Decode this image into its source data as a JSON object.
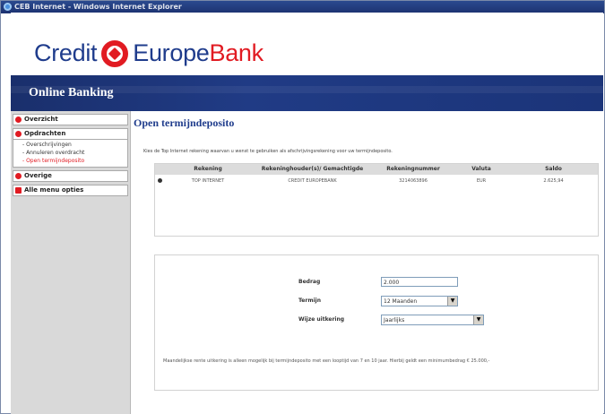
{
  "window": {
    "title": "CEB Internet - Windows Internet Explorer"
  },
  "brand": {
    "logo_word_1": "Credit",
    "logo_word_2": "Europe",
    "logo_word_3": "Bank",
    "brand_red": "#e11b22",
    "brand_blue": "#1f3c8c"
  },
  "banner": {
    "title": "Online Banking"
  },
  "sidebar": {
    "items": [
      {
        "label": "Overzicht"
      },
      {
        "label": "Opdrachten"
      },
      {
        "label": "Overige"
      },
      {
        "label": "Alle menu opties"
      }
    ],
    "sub_items": [
      {
        "label": "- Overschrijvingen"
      },
      {
        "label": "- Annuleren overdracht"
      },
      {
        "label": "- Open termijndeposito"
      }
    ]
  },
  "main": {
    "title": "Open termijndeposito",
    "intro": "Kies de Top Internet rekening waarvan u wenst te gebruiken als afschrijvingsrekening voor uw termijndeposito.",
    "table": {
      "headers": [
        "Rekening",
        "Rekeninghouder(s)/ Gemachtigde",
        "Rekeningnummer",
        "Valuta",
        "Saldo"
      ],
      "rows": [
        {
          "rekening": "TOP INTERNET",
          "houder": "CREDIT EUROPEBANK",
          "nummer": "3214063896",
          "valuta": "EUR",
          "saldo": "2.625,94"
        }
      ]
    },
    "form": {
      "bedrag_label": "Bedrag",
      "bedrag_value": "2.000",
      "termijn_label": "Termijn",
      "termijn_value": "12 Maanden",
      "rente_label": "Wijze uitkering",
      "rente_value": "Jaarlijks",
      "note": "Maandelijkse rente uitkering is alleen mogelijk bij termijndeposito met een looptijd van 7 en 10 jaar. Hierbij geldt een minimumbedrag € 25.000,-"
    }
  }
}
